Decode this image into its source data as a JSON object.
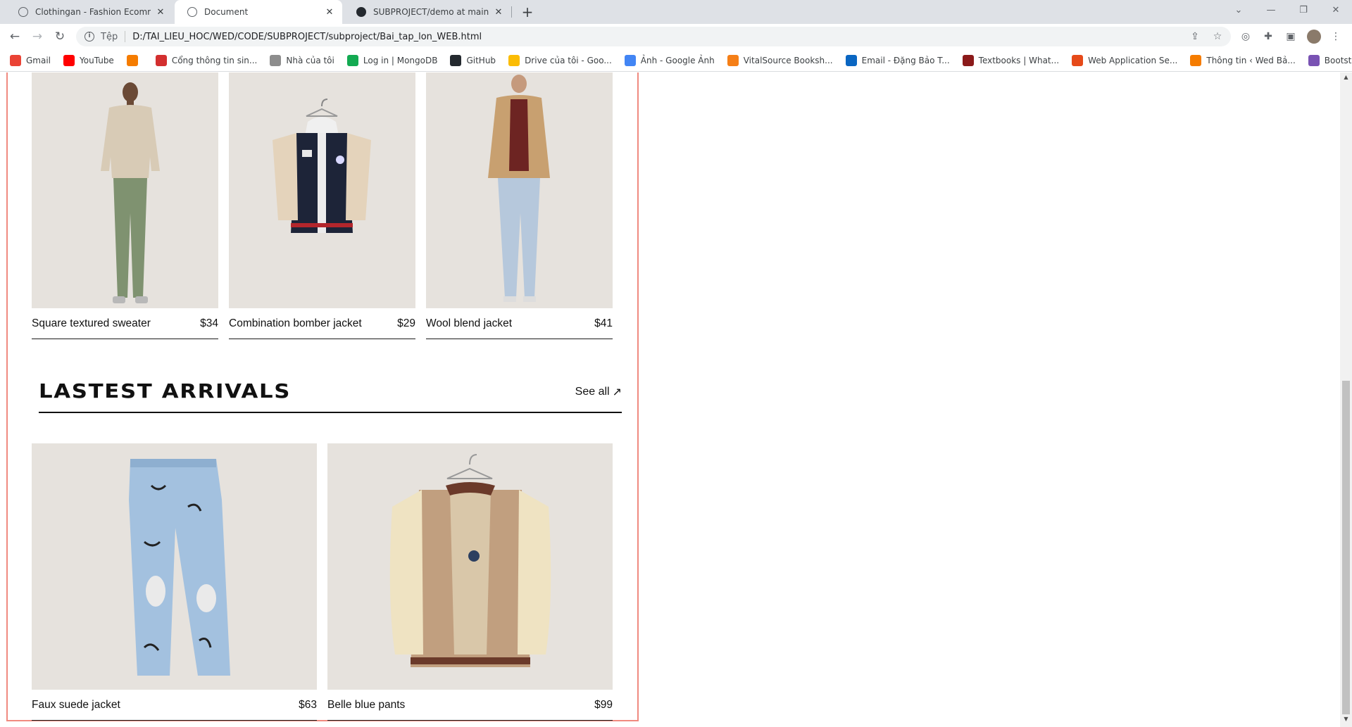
{
  "browser": {
    "tabs": [
      {
        "title": "Clothingan - Fashion Ecommerce",
        "active": false
      },
      {
        "title": "Document",
        "active": true
      },
      {
        "title": "SUBPROJECT/demo at main · bao",
        "active": false
      }
    ],
    "address": {
      "scheme_label": "Tệp",
      "url": "D:/TAI_LIEU_HOC/WED/CODE/SUBPROJECT/subproject/Bai_tap_lon_WEB.html"
    },
    "bookmarks": [
      {
        "label": "Gmail",
        "color": "#ea4335"
      },
      {
        "label": "YouTube",
        "color": "#ff0000"
      },
      {
        "label": "",
        "color": "#f57c00"
      },
      {
        "label": "Cổng thông tin sin...",
        "color": "#d32f2f"
      },
      {
        "label": "Nhà của tôi",
        "color": "#8d8d8d"
      },
      {
        "label": "Log in | MongoDB",
        "color": "#13aa52"
      },
      {
        "label": "GitHub",
        "color": "#24292f"
      },
      {
        "label": "Drive của tôi - Goo...",
        "color": "#fbbc04"
      },
      {
        "label": "Ảnh - Google Ảnh",
        "color": "#4285f4"
      },
      {
        "label": "VitalSource Booksh...",
        "color": "#f57f17"
      },
      {
        "label": "Email - Đặng Bảo T...",
        "color": "#0a66c2"
      },
      {
        "label": "Textbooks | What...",
        "color": "#8b1a1a"
      },
      {
        "label": "Web Application Se...",
        "color": "#e64a19"
      },
      {
        "label": "Thông tin ‹ Wed Bả...",
        "color": "#f57c00"
      },
      {
        "label": "Bootstrap · The mo...",
        "color": "#7952b3"
      }
    ]
  },
  "featured": [
    {
      "name": "Square textured sweater",
      "price": "$34",
      "image": "man-sweater-green-pants"
    },
    {
      "name": "Combination bomber jacket",
      "price": "$29",
      "image": "navy-bomber-on-hanger"
    },
    {
      "name": "Wool blend jacket",
      "price": "$41",
      "image": "man-tan-jacket-jeans"
    }
  ],
  "latest": {
    "title": "LASTEST ARRIVALS",
    "see_all": "See all",
    "see_all_icon": "arrow-up-right-icon",
    "items": [
      {
        "name": "Faux suede jacket",
        "price": "$63",
        "image": "ripped-graffiti-jeans"
      },
      {
        "name": "Belle blue pants",
        "price": "$99",
        "image": "beige-varsity-jacket-on-hanger"
      }
    ]
  },
  "colors": {
    "image_bg": "#e6e2dd",
    "frame": "#f08a80",
    "text": "#111111"
  }
}
